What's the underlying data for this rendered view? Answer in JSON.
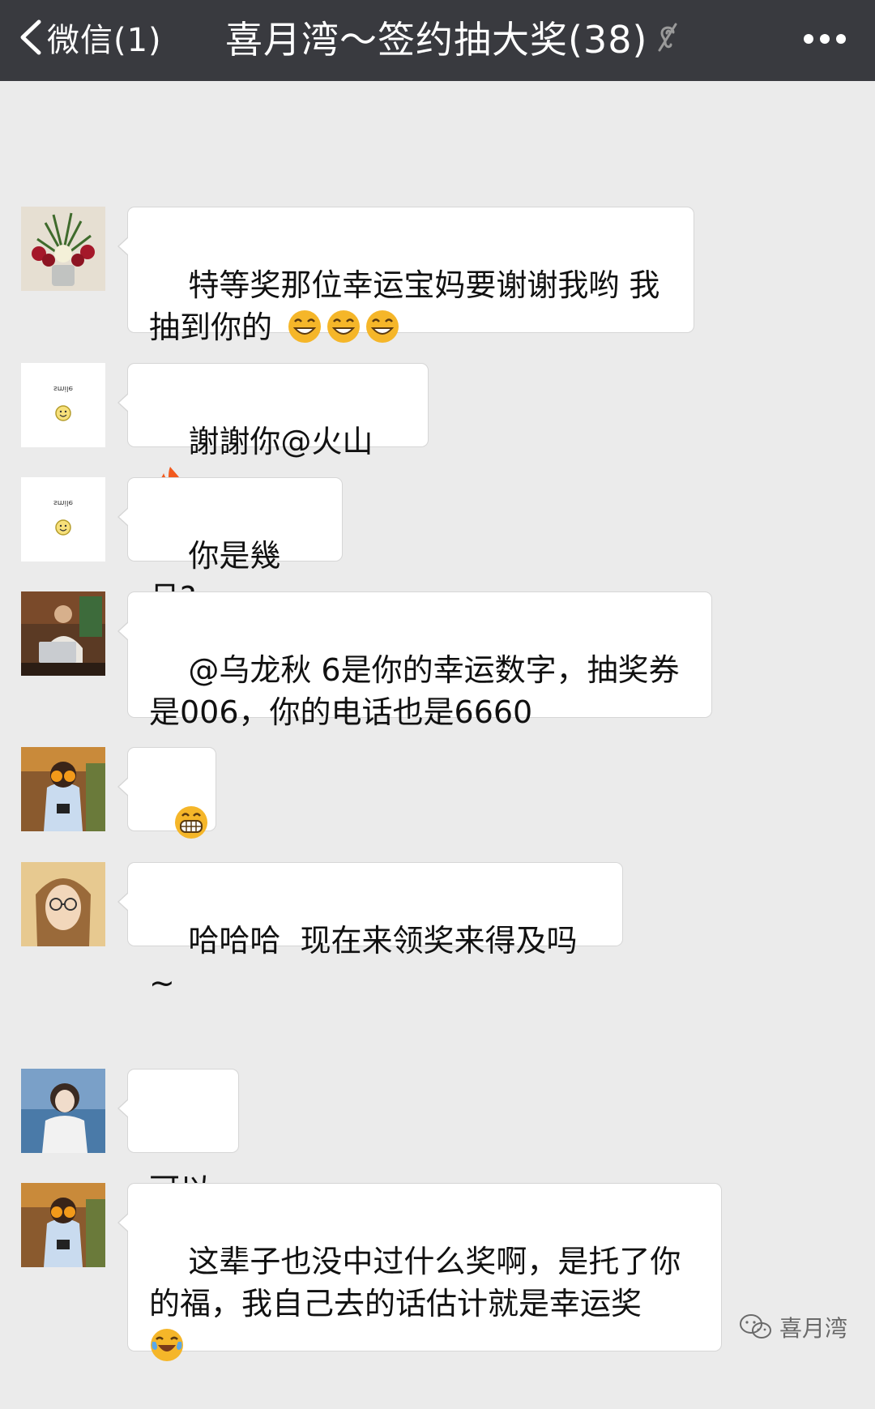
{
  "navbar": {
    "back_label": "微信(1)",
    "title": "喜月湾～签约抽大奖(38)",
    "icons": {
      "back": "chevron-left-icon",
      "mute": "mute-ear-icon",
      "more": "more-dots-icon"
    }
  },
  "messages": [
    {
      "avatar": "flower-bouquet",
      "text": "特等奖那位幸运宝妈要谢谢我哟 我抽到你的",
      "emoji": [
        "grin-emoji",
        "grin-emoji",
        "grin-emoji"
      ]
    },
    {
      "avatar": "smile-sticker",
      "avatar_text": "smile",
      "text": "謝謝你@火山",
      "emoji": [
        "fire-emoji"
      ]
    },
    {
      "avatar": "smile-sticker",
      "avatar_text": "smile",
      "text": "你是幾月?"
    },
    {
      "avatar": "man-with-laptop",
      "text": "@乌龙秋 6是你的幸运数字，抽奖券是006，你的电话也是6660"
    },
    {
      "avatar": "woman-oranges",
      "emoji": [
        "big-grin-emoji"
      ]
    },
    {
      "avatar": "woman-glasses",
      "text": "哈哈哈  现在来领奖来得及吗~"
    },
    {
      "avatar": "woman-lace",
      "text": "可以"
    },
    {
      "avatar": "woman-oranges",
      "text": "这辈子也没中过什么奖啊，是托了你的福，我自己去的话估计就是幸运奖",
      "emoji": [
        "tears-of-joy-emoji"
      ]
    }
  ],
  "watermark": {
    "text": "喜月湾",
    "icon": "wechat-logo-icon"
  },
  "colors": {
    "navbar": "#393a3f",
    "background": "#ebebeb",
    "bubble": "#ffffff",
    "emoji": "#f5b629"
  }
}
